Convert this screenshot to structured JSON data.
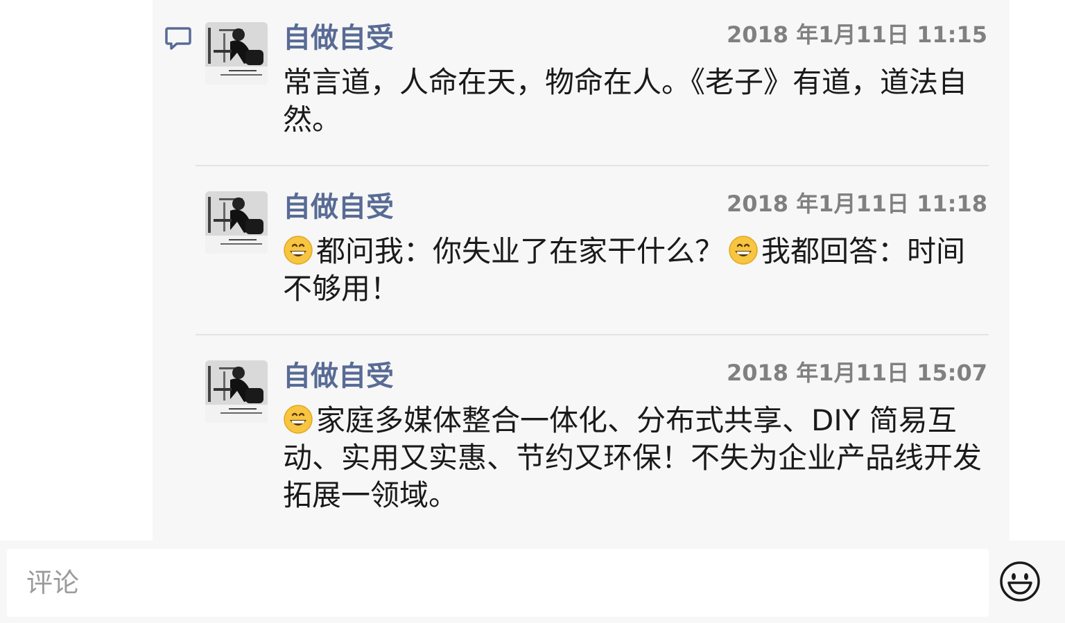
{
  "comments": [
    {
      "author": "自做自受",
      "timestamp": "2018 年1月11日 11:15",
      "text": "常言道，人命在天，物命在人。《老子》有道，道法自然。",
      "leading_emoji": ""
    },
    {
      "author": "自做自受",
      "timestamp": "2018 年1月11日 11:18",
      "text_part1": "都问我：你失业了在家干什么？",
      "text_part2": "我都回答：时间不够用！",
      "leading_emoji": "grinning-face",
      "inline_emoji": "grinning-face"
    },
    {
      "author": "自做自受",
      "timestamp": "2018 年1月11日 15:07",
      "text": "家庭多媒体整合一体化、分布式共享、DIY 简易互动、实用又实惠、节约又环保！不失为企业产品线开发拓展一领域。",
      "leading_emoji": "grinning-face"
    }
  ],
  "input": {
    "placeholder": "评论"
  },
  "icons": {
    "comment": "comment-bubble-icon",
    "emoji_button": "smiley-face-icon"
  },
  "colors": {
    "author": "#586b95",
    "panel_background": "#f7f7f7",
    "timestamp": "#808080",
    "link_icon": "#586b95"
  }
}
